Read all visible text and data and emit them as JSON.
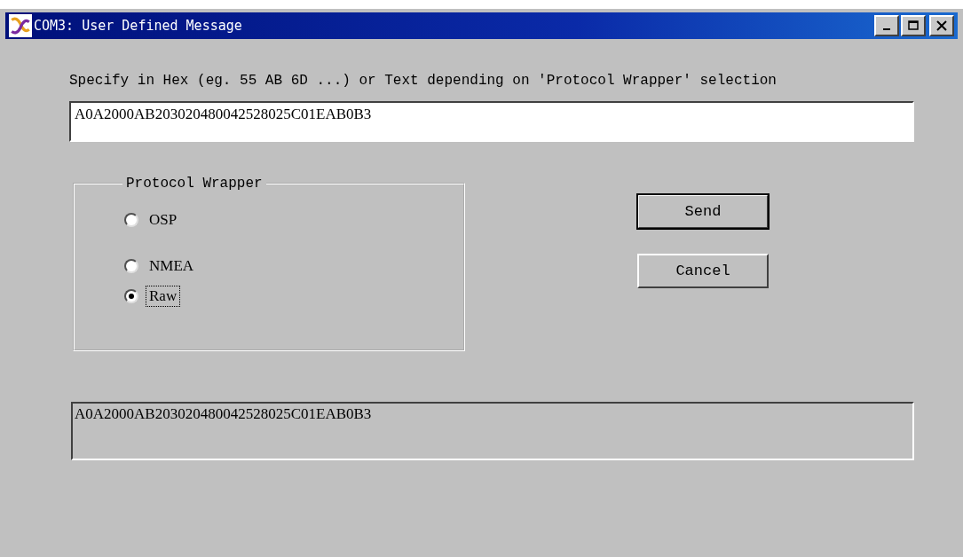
{
  "window": {
    "title": "COM3: User Defined Message"
  },
  "instruction": "Specify in Hex (eg. 55 AB 6D ...) or Text depending on 'Protocol Wrapper' selection",
  "message_input": {
    "value": "A0A2000AB203020480042528025C01EAB0B3"
  },
  "protocol_wrapper": {
    "title": "Protocol Wrapper",
    "options": [
      {
        "label": "OSP",
        "selected": false,
        "focused": false
      },
      {
        "label": "NMEA",
        "selected": false,
        "focused": false
      },
      {
        "label": "Raw",
        "selected": true,
        "focused": true
      }
    ]
  },
  "buttons": [
    {
      "label": "Send",
      "default": true
    },
    {
      "label": "Cancel",
      "default": false
    }
  ],
  "output": {
    "text": "A0A2000AB203020480042528025C01EAB0B3"
  }
}
